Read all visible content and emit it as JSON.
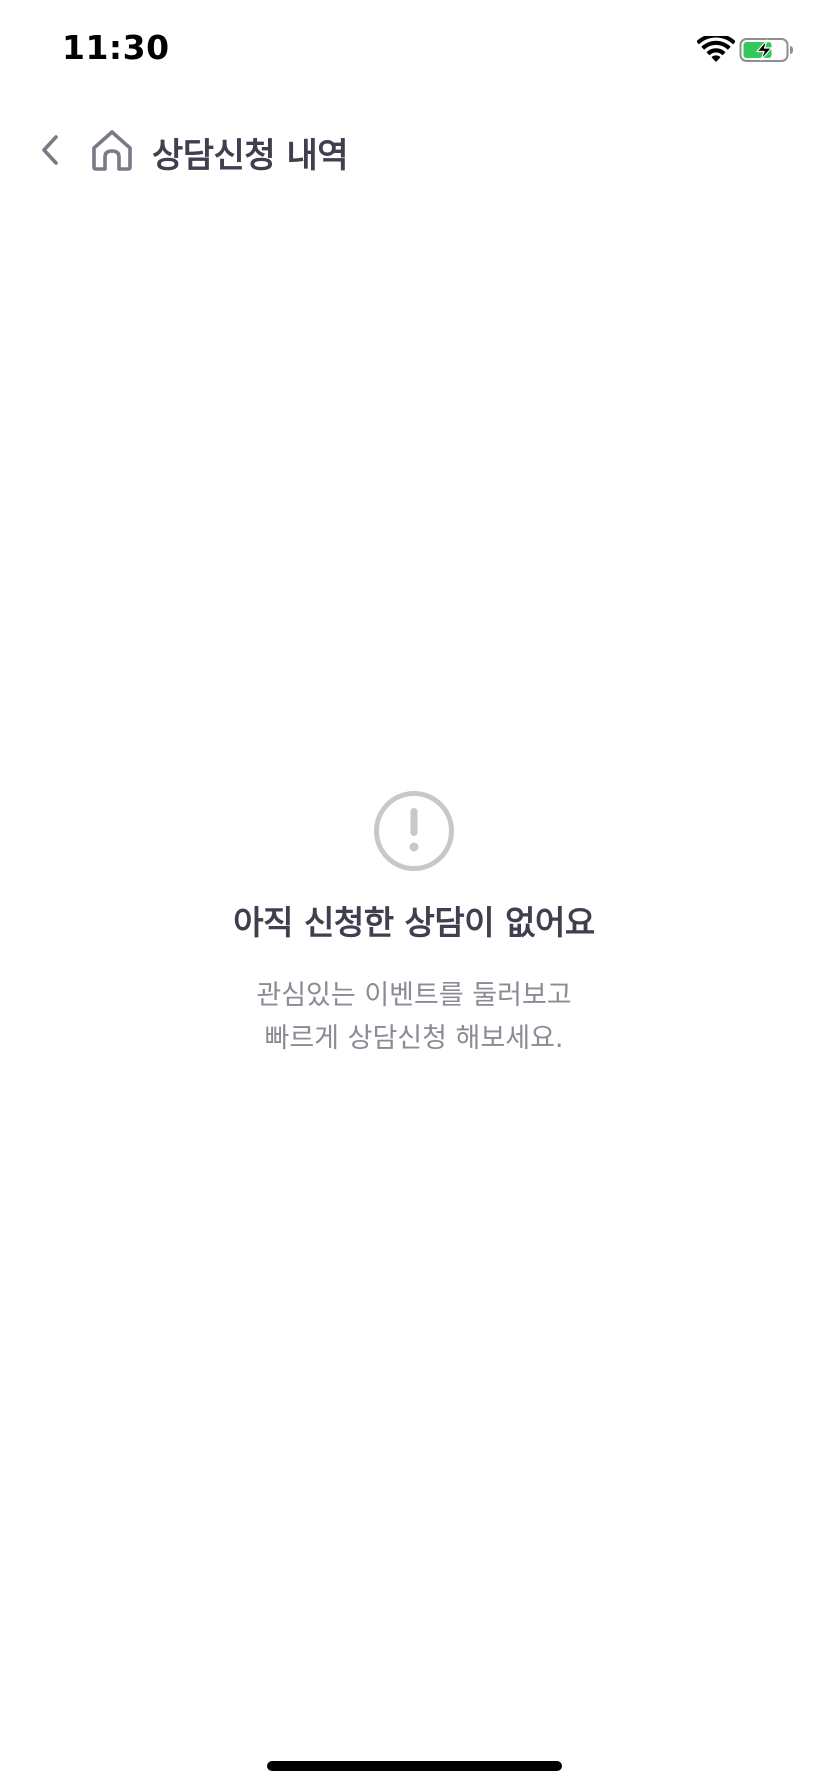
{
  "status_bar": {
    "time": "11:30",
    "wifi_icon": "wifi-icon",
    "battery_icon": "battery-charging-icon",
    "battery_color": "#34c759"
  },
  "nav": {
    "back_icon": "chevron-left-icon",
    "home_icon": "home-icon",
    "title": "상담신청 내역"
  },
  "empty_state": {
    "icon": "exclamation-circle-icon",
    "title": "아직 신청한 상담이 없어요",
    "description_line1": "관심있는 이벤트를 둘러보고",
    "description_line2": "빠르게 상담신청 해보세요."
  },
  "colors": {
    "title_text": "#3f3f4f",
    "secondary_text": "#8b8b96",
    "icon_gray": "#c8c8cc",
    "nav_icon": "#7a7a86",
    "background": "#ffffff"
  }
}
